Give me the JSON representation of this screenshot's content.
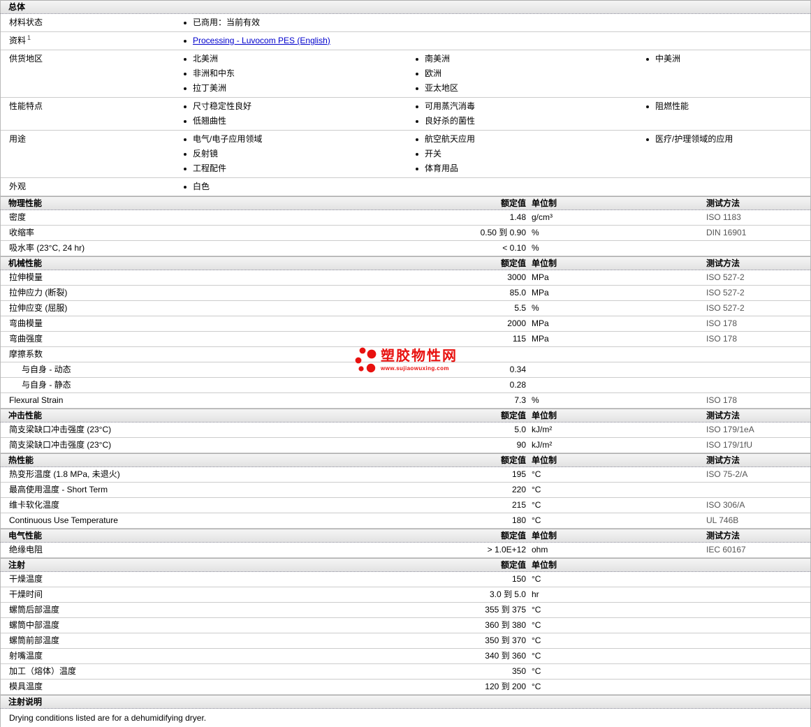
{
  "colors": {
    "accent_red": "#e8110f",
    "link_blue": "#0000cc",
    "header_bg": "#e7e7e7",
    "row_border": "#cccccc",
    "method_text": "#555555"
  },
  "columns": {
    "rating": "额定值",
    "unit": "单位制",
    "method": "测试方法"
  },
  "watermark": {
    "title": "塑胶物性网",
    "url": "www.sujiaowuxing.com"
  },
  "rows": [
    {
      "t": "h",
      "label": "总体",
      "cols": ""
    },
    {
      "t": "b",
      "label": "材料状态",
      "lists": [
        [
          "已商用：当前有效"
        ],
        [],
        []
      ]
    },
    {
      "t": "b",
      "label": "资料",
      "sup": "1",
      "lists": [
        [
          {
            "text": "Processing - Luvocom PES (English)",
            "link": true
          }
        ],
        [],
        []
      ]
    },
    {
      "t": "b",
      "label": "供货地区",
      "lists": [
        [
          "北美洲",
          "非洲和中东",
          "拉丁美洲"
        ],
        [
          "南美洲",
          "欧洲",
          "亚太地区"
        ],
        [
          "中美洲"
        ]
      ]
    },
    {
      "t": "b",
      "label": "性能特点",
      "lists": [
        [
          "尺寸稳定性良好",
          "低翘曲性"
        ],
        [
          "可用蒸汽消毒",
          "良好杀的菌性"
        ],
        [
          "阻燃性能"
        ]
      ]
    },
    {
      "t": "b",
      "label": "用途",
      "lists": [
        [
          "电气/电子应用领域",
          "反射镜",
          "工程配件"
        ],
        [
          "航空航天应用",
          "开关",
          "体育用品"
        ],
        [
          "医疗/护理领域的应用"
        ]
      ]
    },
    {
      "t": "b",
      "label": "外观",
      "lists": [
        [
          "白色"
        ],
        [],
        []
      ]
    },
    {
      "t": "h",
      "label": "物理性能",
      "cols": "vum"
    },
    {
      "t": "v",
      "label": "密度",
      "value": "1.48",
      "unit": "g/cm³",
      "method": "ISO 1183"
    },
    {
      "t": "v",
      "label": "收缩率",
      "value": "0.50 到 0.90",
      "unit": "%",
      "method": "DIN 16901"
    },
    {
      "t": "v",
      "label": "吸水率  (23°C, 24 hr)",
      "value": "< 0.10",
      "unit": "%",
      "method": ""
    },
    {
      "t": "h",
      "label": "机械性能",
      "cols": "vum"
    },
    {
      "t": "v",
      "label": "拉伸模量",
      "value": "3000",
      "unit": "MPa",
      "method": "ISO 527-2"
    },
    {
      "t": "v",
      "label": "拉伸应力 (断裂)",
      "value": "85.0",
      "unit": "MPa",
      "method": "ISO 527-2"
    },
    {
      "t": "v",
      "label": "拉伸应变 (屈服)",
      "value": "5.5",
      "unit": "%",
      "method": "ISO 527-2"
    },
    {
      "t": "v",
      "label": "弯曲模量",
      "value": "2000",
      "unit": "MPa",
      "method": "ISO 178"
    },
    {
      "t": "v",
      "label": "弯曲强度",
      "value": "115",
      "unit": "MPa",
      "method": "ISO 178"
    },
    {
      "t": "v",
      "label": "摩擦系数",
      "value": "",
      "unit": "",
      "method": ""
    },
    {
      "t": "v",
      "label": "与自身  - 动态",
      "indent": true,
      "value": "0.34",
      "unit": "",
      "method": ""
    },
    {
      "t": "v",
      "label": "与自身  - 静态",
      "indent": true,
      "value": "0.28",
      "unit": "",
      "method": ""
    },
    {
      "t": "v",
      "label": "Flexural Strain",
      "value": "7.3",
      "unit": "%",
      "method": "ISO 178"
    },
    {
      "t": "h",
      "label": "冲击性能",
      "cols": "vum"
    },
    {
      "t": "v",
      "label": "简支梁缺口冲击强度  (23°C)",
      "value": "5.0",
      "unit": "kJ/m²",
      "method": "ISO 179/1eA"
    },
    {
      "t": "v",
      "label": "简支梁缺口冲击强度  (23°C)",
      "value": "90",
      "unit": "kJ/m²",
      "method": "ISO 179/1fU"
    },
    {
      "t": "h",
      "label": "热性能",
      "cols": "vum"
    },
    {
      "t": "v",
      "label": "热变形温度  (1.8 MPa, 未退火)",
      "value": "195",
      "unit": "°C",
      "method": "ISO 75-2/A"
    },
    {
      "t": "v",
      "label": "最高使用温度  - Short Term",
      "value": "220",
      "unit": "°C",
      "method": ""
    },
    {
      "t": "v",
      "label": "维卡软化温度",
      "value": "215",
      "unit": "°C",
      "method": "ISO 306/A"
    },
    {
      "t": "v",
      "label": "Continuous Use Temperature",
      "value": "180",
      "unit": "°C",
      "method": "UL 746B"
    },
    {
      "t": "h",
      "label": "电气性能",
      "cols": "vum"
    },
    {
      "t": "v",
      "label": "绝缘电阻",
      "value": "> 1.0E+12",
      "unit": "ohm",
      "method": "IEC 60167"
    },
    {
      "t": "h",
      "label": "注射",
      "cols": "vu"
    },
    {
      "t": "v",
      "label": "干燥温度",
      "value": "150",
      "unit": "°C",
      "method": ""
    },
    {
      "t": "v",
      "label": "干燥时间",
      "value": "3.0 到  5.0",
      "unit": "hr",
      "method": ""
    },
    {
      "t": "v",
      "label": "螺筒后部温度",
      "value": "355 到  375",
      "unit": "°C",
      "method": ""
    },
    {
      "t": "v",
      "label": "螺筒中部温度",
      "value": "360 到  380",
      "unit": "°C",
      "method": ""
    },
    {
      "t": "v",
      "label": "螺筒前部温度",
      "value": "350 到  370",
      "unit": "°C",
      "method": ""
    },
    {
      "t": "v",
      "label": "射嘴温度",
      "value": "340 到  360",
      "unit": "°C",
      "method": ""
    },
    {
      "t": "v",
      "label": "加工（熔体）温度",
      "value": "350",
      "unit": "°C",
      "method": ""
    },
    {
      "t": "v",
      "label": "模具温度",
      "value": "120 到  200",
      "unit": "°C",
      "method": ""
    },
    {
      "t": "h",
      "label": "注射说明",
      "cols": ""
    },
    {
      "t": "n",
      "text": "Drying conditions listed are for a dehumidifying dryer."
    }
  ]
}
